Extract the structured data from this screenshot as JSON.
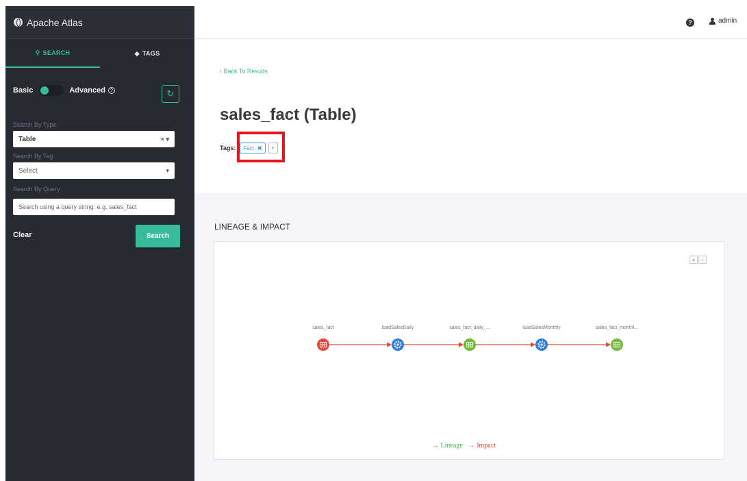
{
  "app": {
    "title": "Apache Atlas"
  },
  "sidebar": {
    "tabs": [
      {
        "label": "SEARCH",
        "icon": "search-icon"
      },
      {
        "label": "TAGS",
        "icon": "tag-icon"
      }
    ],
    "mode": {
      "basic_label": "Basic",
      "advanced_label": "Advanced",
      "help": "?"
    },
    "search_by_type": {
      "label": "Search By Type",
      "value": "Table",
      "controls": "× ▾"
    },
    "search_by_tag": {
      "label": "Search By Tag",
      "placeholder": "Select",
      "caret": "▾"
    },
    "search_by_query": {
      "label": "Search By Query",
      "placeholder": "Search using a query string: e.g. sales_fact"
    },
    "clear_label": "Clear",
    "search_label": "Search",
    "accent_color": "#37bb9b"
  },
  "header": {
    "help_icon": "?",
    "user": "admin"
  },
  "main": {
    "back_label": "‹ Back To Results",
    "title": "sales_fact (Table)",
    "tags_label": "Tags:",
    "tags": [
      {
        "name": "Fact",
        "remove": "✖"
      }
    ],
    "add_tag": "+"
  },
  "lineage": {
    "title": "LINEAGE & IMPACT",
    "zoom_in": "+",
    "zoom_out": "-",
    "nodes": [
      {
        "label": "sales_fact",
        "kind": "table",
        "color": "#e84a3a"
      },
      {
        "label": "loadSalesDaily",
        "kind": "process",
        "color": "#2f7fe0"
      },
      {
        "label": "sales_fact_daily_...",
        "kind": "table",
        "color": "#6fbf3a"
      },
      {
        "label": "loadSalesMonthly",
        "kind": "process",
        "color": "#2f7fe0"
      },
      {
        "label": "sales_fact_monthl...",
        "kind": "table",
        "color": "#6fbf3a"
      }
    ],
    "edge_color": "#e84a3a",
    "legend": {
      "lineage": "→ Lineage",
      "impact": "→ Impact",
      "lineage_color": "#4caf50",
      "impact_color": "#e84a3a"
    }
  }
}
